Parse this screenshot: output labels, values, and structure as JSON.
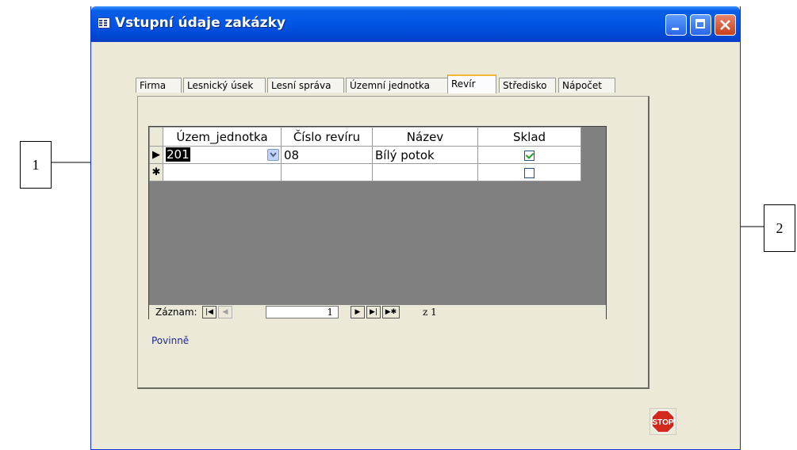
{
  "window": {
    "title": "Vstupní údaje zakázky"
  },
  "tabs": [
    {
      "label": "Firma",
      "active": false
    },
    {
      "label": "Lesnický úsek",
      "active": false
    },
    {
      "label": "Lesní správa",
      "active": false
    },
    {
      "label": "Územní jednotka",
      "active": false
    },
    {
      "label": "Revír",
      "active": true
    },
    {
      "label": "Středisko",
      "active": false
    },
    {
      "label": "Nápočet",
      "active": false
    }
  ],
  "grid": {
    "columns": [
      "Územ_jednotka",
      "Číslo revíru",
      "Název",
      "Sklad"
    ],
    "rows": [
      {
        "selector": "▶",
        "uzem_jednotka": "201",
        "cislo_reviru": "08",
        "nazev": "Bílý potok",
        "sklad": true
      },
      {
        "selector": "✱",
        "uzem_jednotka": "",
        "cislo_reviru": "",
        "nazev": "",
        "sklad": false
      }
    ]
  },
  "navigator": {
    "label": "Záznam:",
    "current": "1",
    "of_label": "z 1"
  },
  "status": {
    "required_label": "Povinně"
  },
  "stop_button": {
    "label": "STOP",
    "color": "#d4281c"
  },
  "callouts": {
    "first": "1",
    "second": "2"
  },
  "colors": {
    "titlebar": "#0055e5",
    "window_bg": "#ece9d8",
    "subform_bg": "#808080",
    "active_tab_accent": "#f2b632",
    "required_text": "#1a2a9a"
  }
}
